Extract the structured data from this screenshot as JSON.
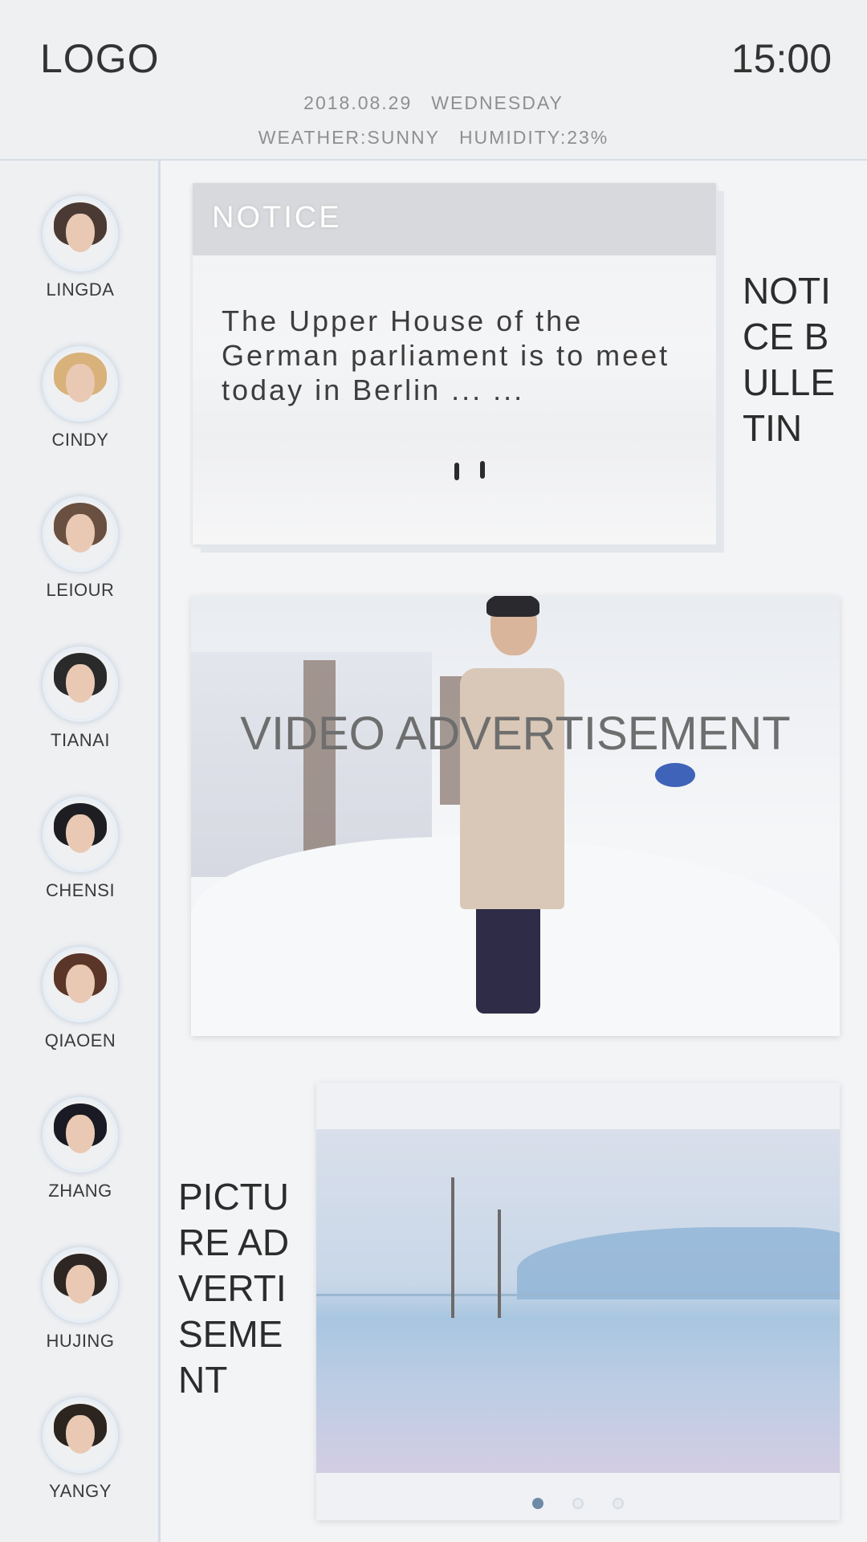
{
  "header": {
    "logo": "LOGO",
    "time": "15:00",
    "date": "2018.08.29",
    "weekday": "WEDNESDAY",
    "weather": "WEATHER:SUNNY",
    "humidity": "HUMIDITY:23%"
  },
  "sidebar": {
    "people": [
      {
        "name": "LINGDA",
        "avatar": "avatar-lingda",
        "hair": "#4a3a33"
      },
      {
        "name": "CINDY",
        "avatar": "avatar-cindy",
        "hair": "#d8b27a"
      },
      {
        "name": "LEIOUR",
        "avatar": "avatar-leiour",
        "hair": "#6a5040"
      },
      {
        "name": "TIANAI",
        "avatar": "avatar-tianai",
        "hair": "#2a2a2a"
      },
      {
        "name": "CHENSI",
        "avatar": "avatar-chensi",
        "hair": "#1e1e22"
      },
      {
        "name": "QIAOEN",
        "avatar": "avatar-qiaoen",
        "hair": "#5a3528"
      },
      {
        "name": "ZHANG",
        "avatar": "avatar-zhang",
        "hair": "#1a1a24"
      },
      {
        "name": "HUJING",
        "avatar": "avatar-hujing",
        "hair": "#2e2622"
      },
      {
        "name": "YANGY",
        "avatar": "avatar-yangy",
        "hair": "#2b241f"
      }
    ]
  },
  "notice": {
    "title": "NOTICE",
    "text": "The Upper House of the German parliament is to meet today in Berlin ... ...",
    "side_label": "NOTICE BULLETIN"
  },
  "video": {
    "title": "VIDEO ADVERTISEMENT"
  },
  "picture": {
    "side_label": "PICTURE ADVERTISEMENT",
    "pages": 3,
    "active_page": 1
  },
  "colors": {
    "background": "#f3f4f6",
    "header": "#eff0f2",
    "divider": "#d7dde5",
    "notice_header": "#d8d9dc",
    "dot_active": "#6d8ba6"
  }
}
